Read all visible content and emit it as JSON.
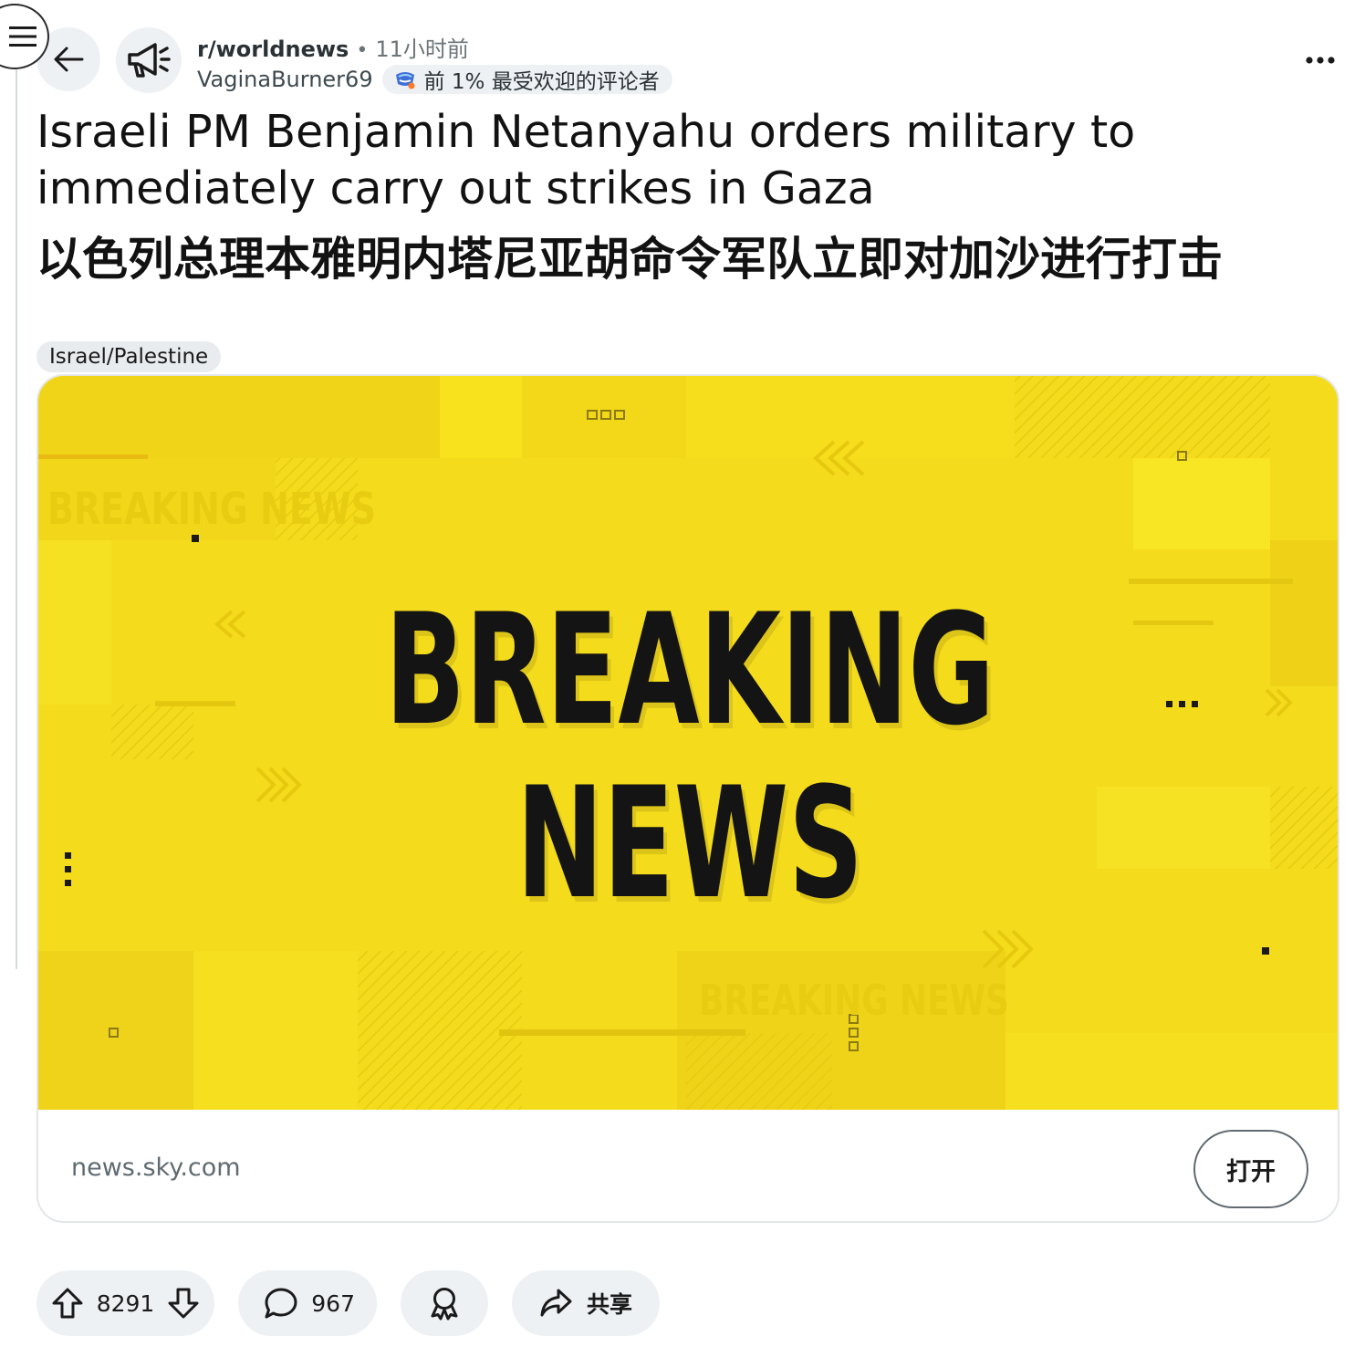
{
  "post": {
    "subreddit": "r/worldnews",
    "separator": "•",
    "time_ago": "11小时前",
    "author": "VaginaBurner69",
    "author_flair": "前 1% 最受欢迎的评论者",
    "title_en": "Israeli PM Benjamin Netanyahu orders military to immediately carry out strikes in Gaza",
    "title_zh": "以色列总理本雅明内塔尼亚胡命令军队立即对加沙进行打击",
    "post_flair": "Israel/Palestine"
  },
  "link_card": {
    "thumbnail_headline_line1": "BREAKING",
    "thumbnail_headline_line2": "NEWS",
    "thumbnail_watermark": "BREAKING NEWS",
    "domain": "news.sky.com",
    "open_label": "打开"
  },
  "actions": {
    "upvotes": "8291",
    "comments": "967",
    "share_label": "共享"
  },
  "icons": {
    "menu": "hamburger-menu-icon",
    "back": "arrow-left-icon",
    "subreddit": "megaphone-icon",
    "flair": "top-commenter-icon",
    "more": "ellipsis-icon",
    "upvote": "arrow-up-icon",
    "downvote": "arrow-down-icon",
    "comment": "speech-bubble-icon",
    "award": "award-icon",
    "share": "share-arrow-icon"
  },
  "colors": {
    "thumbnail_yellow": "#f4dc1c",
    "pill_background": "#eef1f3",
    "muted_text": "#6b7478"
  }
}
